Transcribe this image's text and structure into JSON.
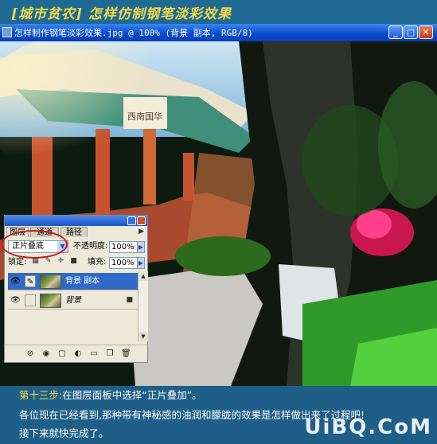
{
  "banner": {
    "text": "[城市贫农]  怎样仿制钢笔淡彩效果"
  },
  "window": {
    "title": "怎样制作钢笔淡彩效果.jpg @ 100% (背景 副本, RGB/8)",
    "buttons": {
      "minimize": "_",
      "maximize": "□",
      "close": "✕"
    }
  },
  "layers_panel": {
    "tabs": [
      "图层",
      "通道",
      "路径"
    ],
    "blend_mode": "正片叠底",
    "opacity_label": "不透明度:",
    "opacity_value": "100%",
    "lock_label": "锁定:",
    "fill_label": "填充:",
    "fill_value": "100%",
    "layers": [
      {
        "name": "背景 副本",
        "selected": true
      },
      {
        "name": "背景",
        "selected": false
      }
    ]
  },
  "caption": {
    "step_label": "第十三步:",
    "line1": "在图层面板中选择“正片叠加”。",
    "line2": "各位现在已经看到,那种带有神秘感的油润和朦胧的效果是怎样做出来了过程吧!",
    "line3": "接下来就快完成了。"
  },
  "watermark": "UiBQ.CoM",
  "colors": {
    "accent": "#f2d94a",
    "background": "#1f5f87",
    "selection": "#3169c6",
    "highlight_circle": "#c8181c"
  }
}
